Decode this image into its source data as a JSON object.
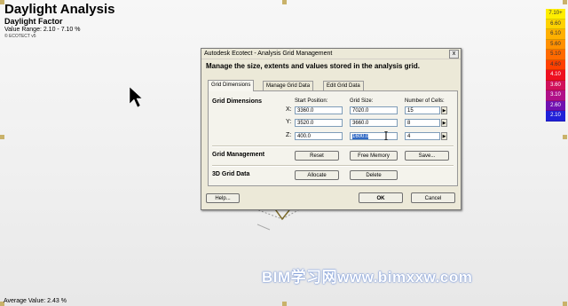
{
  "viewport": {
    "title": "Daylight Analysis",
    "subtitle": "Daylight Factor",
    "value_range": "Value Range: 2.10 - 7.10 %",
    "brand": "© ECOTECT v5",
    "average_value": "Average Value: 2.43 %"
  },
  "legend": {
    "items": [
      {
        "label": "7.10+",
        "color": "#ffee00"
      },
      {
        "label": "6.60",
        "color": "#ffd200"
      },
      {
        "label": "6.10",
        "color": "#ffb000"
      },
      {
        "label": "5.60",
        "color": "#ff9000"
      },
      {
        "label": "5.10",
        "color": "#ff6a00"
      },
      {
        "label": "4.60",
        "color": "#ff4000"
      },
      {
        "label": "4.10",
        "color": "#ee1020"
      },
      {
        "label": "3.60",
        "color": "#d0105a"
      },
      {
        "label": "3.10",
        "color": "#b01088"
      },
      {
        "label": "2.60",
        "color": "#7010b0"
      },
      {
        "label": "2.10",
        "color": "#2020d8"
      }
    ]
  },
  "dialog": {
    "title": "Autodesk Ecotect - Analysis Grid Management",
    "close_label": "x",
    "heading": "Manage the size, extents and values stored in the analysis grid.",
    "tabs": [
      "Grid Dimensions",
      "Manage Grid Data",
      "Edit Grid Data"
    ],
    "grid_dimensions": {
      "label": "Grid Dimensions",
      "col_start": "Start Position:",
      "col_size": "Grid Size:",
      "col_cells": "Number of Cells:",
      "rows": [
        {
          "axis": "X:",
          "start": "3360.0",
          "size": "7020.0",
          "cells": "15"
        },
        {
          "axis": "Y:",
          "start": "3520.0",
          "size": "3660.0",
          "cells": "8"
        },
        {
          "axis": "Z:",
          "start": "400.0",
          "size": "1600.0",
          "cells": "4"
        }
      ]
    },
    "grid_management": {
      "label": "Grid Management",
      "reset": "Reset",
      "free_memory": "Free Memory",
      "save": "Save..."
    },
    "grid_data": {
      "label": "3D Grid Data",
      "allocate": "Allocate",
      "delete": "Delete"
    },
    "help": "Help...",
    "ok": "OK",
    "cancel": "Cancel"
  },
  "watermark": "BIM学习网www.bimxxw.com"
}
